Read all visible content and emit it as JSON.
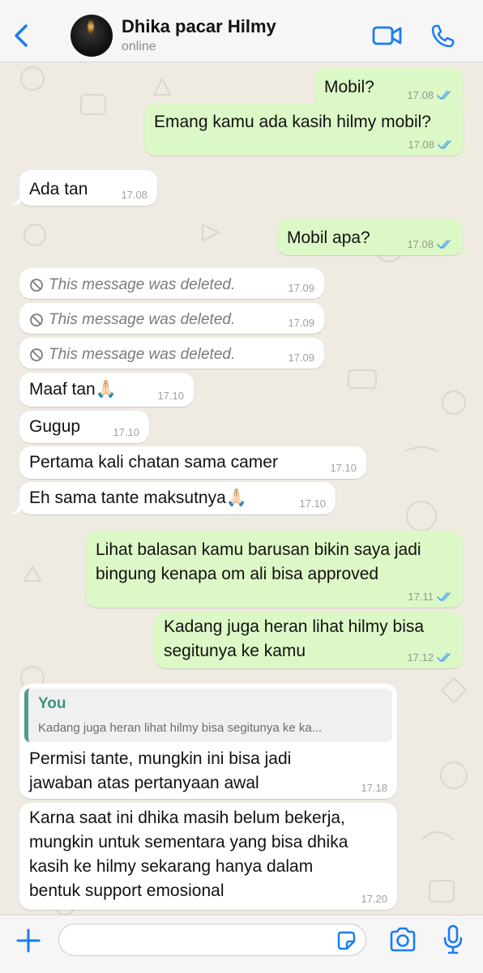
{
  "header": {
    "contact_name": "Dhika pacar Hilmy",
    "status": "online"
  },
  "messages": [
    {
      "text": "Mobil?",
      "time": "17.08"
    },
    {
      "text": "Emang kamu ada kasih hilmy mobil?",
      "time": "17.08"
    },
    {
      "text": "Ada tan",
      "time": "17.08"
    },
    {
      "text": "Mobil apa?",
      "time": "17.08"
    },
    {
      "text": "This message was deleted.",
      "time": "17.09"
    },
    {
      "text": "This message was deleted.",
      "time": "17.09"
    },
    {
      "text": "This message was deleted.",
      "time": "17.09"
    },
    {
      "text": "Maaf tan🙏🏻",
      "time": "17.10"
    },
    {
      "text": "Gugup",
      "time": "17.10"
    },
    {
      "text": "Pertama kali chatan sama camer",
      "time": "17.10"
    },
    {
      "text": "Eh sama tante maksutnya🙏🏻",
      "time": "17.10"
    },
    {
      "line1": "Lihat balasan kamu barusan bikin saya jadi",
      "line2": "bingung kenapa om ali bisa approved",
      "time": "17.11"
    },
    {
      "line1": "Kadang juga heran lihat hilmy bisa",
      "line2": "segitunya ke kamu",
      "time": "17.12"
    },
    {
      "quote_author": "You",
      "quote_text": "Kadang juga heran lihat hilmy bisa segitunya ke ka...",
      "line1": "Permisi tante, mungkin ini bisa jadi",
      "line2": "jawaban atas pertanyaan awal",
      "time": "17.18"
    },
    {
      "line1": "Karna saat ini dhika masih belum bekerja,",
      "line2": "mungkin untuk sementara yang bisa dhika",
      "line3": "kasih ke hilmy sekarang hanya dalam",
      "line4": "bentuk support emosional",
      "time": "17.20"
    }
  ],
  "composer": {
    "value": "",
    "placeholder": ""
  },
  "colors": {
    "accent": "#1a7cf5",
    "outgoing_bubble": "#dcf8c6",
    "incoming_bubble": "#ffffff",
    "read_ticks": "#4fa8e8",
    "reply_bar": "#4e9c8a"
  },
  "icons": [
    "back-chevron-icon",
    "video-call-icon",
    "voice-call-icon",
    "double-check-icon",
    "deleted-icon",
    "plus-icon",
    "sticker-icon",
    "camera-icon",
    "microphone-icon"
  ]
}
